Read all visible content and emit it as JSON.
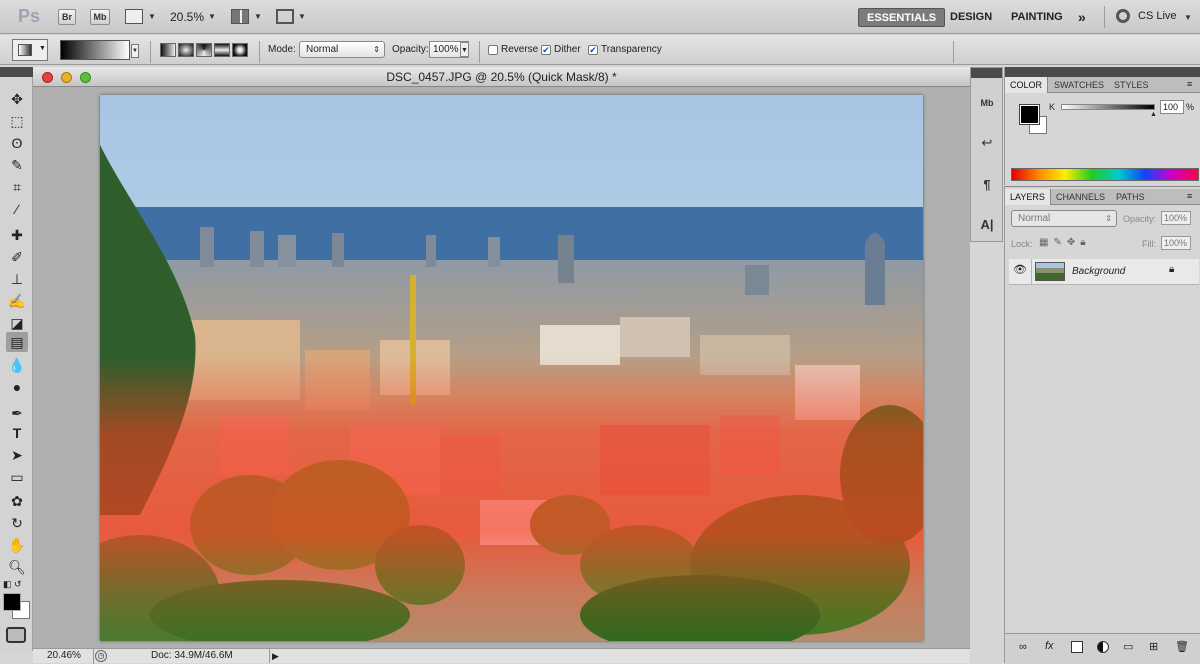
{
  "app": {
    "logo": "Ps",
    "bridge": "Br",
    "minibridge": "Mb",
    "zoom": "20.5%",
    "workspaces": [
      "ESSENTIALS",
      "DESIGN",
      "PAINTING"
    ],
    "more": "»",
    "cslive": "CS Live"
  },
  "options": {
    "mode_label": "Mode:",
    "mode_value": "Normal",
    "opacity_label": "Opacity:",
    "opacity_value": "100%",
    "reverse_label": "Reverse",
    "dither_label": "Dither",
    "transparency_label": "Transparency",
    "reverse_checked": false,
    "dither_checked": true,
    "transparency_checked": true
  },
  "document": {
    "title": "DSC_0457.JPG @ 20.5% (Quick Mask/8) *",
    "status_zoom": "20.46%",
    "status_doc": "Doc: 34.9M/46.6M"
  },
  "color_panel": {
    "tabs": [
      "COLOR",
      "SWATCHES",
      "STYLES"
    ],
    "channel": "K",
    "value": "100",
    "unit": "%"
  },
  "layers_panel": {
    "tabs": [
      "LAYERS",
      "CHANNELS",
      "PATHS"
    ],
    "blend": "Normal",
    "opacity_label": "Opacity:",
    "opacity_value": "100%",
    "lock_label": "Lock:",
    "fill_label": "Fill:",
    "fill_value": "100%",
    "layer_name": "Background"
  },
  "colors": {
    "accent": "#7b7b7b",
    "quickmask": "#ff3a20"
  }
}
